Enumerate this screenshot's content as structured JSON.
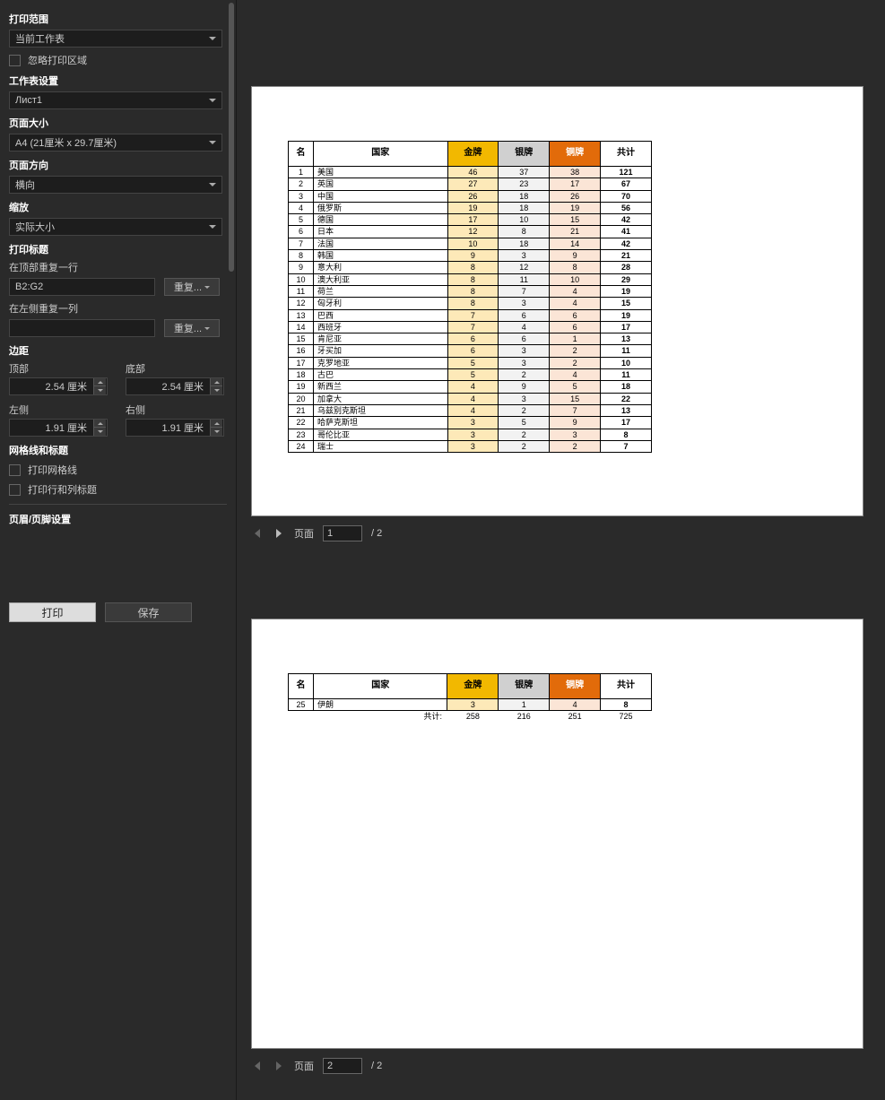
{
  "sidebar": {
    "print_range": {
      "title": "打印范围",
      "value": "当前工作表"
    },
    "ignore_print_area": "忽略打印区域",
    "sheet_settings": {
      "title": "工作表设置",
      "value": "Лист1"
    },
    "page_size": {
      "title": "页面大小",
      "value": "A4 (21厘米 x 29.7厘米)"
    },
    "page_orientation": {
      "title": "页面方向",
      "value": "横向"
    },
    "scaling": {
      "title": "缩放",
      "value": "实际大小"
    },
    "print_titles": {
      "title": "打印标题",
      "repeat_row_label": "在顶部重复一行",
      "repeat_row_value": "B2:G2",
      "repeat_col_label": "在左侧重复一列",
      "repeat_button": "重复..."
    },
    "margins": {
      "title": "边距",
      "top_label": "顶部",
      "bottom_label": "底部",
      "left_label": "左侧",
      "right_label": "右侧",
      "top": "2.54 厘米",
      "bottom": "2.54 厘米",
      "left": "1.91 厘米",
      "right": "1.91 厘米"
    },
    "gridlines": {
      "title": "网格线和标题",
      "print_gridlines": "打印网格线",
      "print_headings": "打印行和列标题"
    },
    "header_footer": "页眉/页脚设置",
    "print_button": "打印",
    "save_button": "保存"
  },
  "headers": {
    "rank": "名",
    "country": "国家",
    "gold": "金牌",
    "silver": "银牌",
    "bronze": "铜牌",
    "total": "共计"
  },
  "page1_rows": [
    {
      "rank": "1",
      "country": "美国",
      "gold": "46",
      "silver": "37",
      "bronze": "38",
      "total": "121"
    },
    {
      "rank": "2",
      "country": "英国",
      "gold": "27",
      "silver": "23",
      "bronze": "17",
      "total": "67"
    },
    {
      "rank": "3",
      "country": "中国",
      "gold": "26",
      "silver": "18",
      "bronze": "26",
      "total": "70"
    },
    {
      "rank": "4",
      "country": "俄罗斯",
      "gold": "19",
      "silver": "18",
      "bronze": "19",
      "total": "56"
    },
    {
      "rank": "5",
      "country": "德国",
      "gold": "17",
      "silver": "10",
      "bronze": "15",
      "total": "42"
    },
    {
      "rank": "6",
      "country": "日本",
      "gold": "12",
      "silver": "8",
      "bronze": "21",
      "total": "41"
    },
    {
      "rank": "7",
      "country": "法国",
      "gold": "10",
      "silver": "18",
      "bronze": "14",
      "total": "42"
    },
    {
      "rank": "8",
      "country": "韩国",
      "gold": "9",
      "silver": "3",
      "bronze": "9",
      "total": "21"
    },
    {
      "rank": "9",
      "country": "意大利",
      "gold": "8",
      "silver": "12",
      "bronze": "8",
      "total": "28"
    },
    {
      "rank": "10",
      "country": "澳大利亚",
      "gold": "8",
      "silver": "11",
      "bronze": "10",
      "total": "29"
    },
    {
      "rank": "11",
      "country": "荷兰",
      "gold": "8",
      "silver": "7",
      "bronze": "4",
      "total": "19"
    },
    {
      "rank": "12",
      "country": "匈牙利",
      "gold": "8",
      "silver": "3",
      "bronze": "4",
      "total": "15"
    },
    {
      "rank": "13",
      "country": "巴西",
      "gold": "7",
      "silver": "6",
      "bronze": "6",
      "total": "19"
    },
    {
      "rank": "14",
      "country": "西班牙",
      "gold": "7",
      "silver": "4",
      "bronze": "6",
      "total": "17"
    },
    {
      "rank": "15",
      "country": "肯尼亚",
      "gold": "6",
      "silver": "6",
      "bronze": "1",
      "total": "13"
    },
    {
      "rank": "16",
      "country": "牙买加",
      "gold": "6",
      "silver": "3",
      "bronze": "2",
      "total": "11"
    },
    {
      "rank": "17",
      "country": "克罗地亚",
      "gold": "5",
      "silver": "3",
      "bronze": "2",
      "total": "10"
    },
    {
      "rank": "18",
      "country": "古巴",
      "gold": "5",
      "silver": "2",
      "bronze": "4",
      "total": "11"
    },
    {
      "rank": "19",
      "country": "新西兰",
      "gold": "4",
      "silver": "9",
      "bronze": "5",
      "total": "18"
    },
    {
      "rank": "20",
      "country": "加拿大",
      "gold": "4",
      "silver": "3",
      "bronze": "15",
      "total": "22"
    },
    {
      "rank": "21",
      "country": "乌兹别克斯坦",
      "gold": "4",
      "silver": "2",
      "bronze": "7",
      "total": "13"
    },
    {
      "rank": "22",
      "country": "哈萨克斯坦",
      "gold": "3",
      "silver": "5",
      "bronze": "9",
      "total": "17"
    },
    {
      "rank": "23",
      "country": "哥伦比亚",
      "gold": "3",
      "silver": "2",
      "bronze": "3",
      "total": "8"
    },
    {
      "rank": "24",
      "country": "瑞士",
      "gold": "3",
      "silver": "2",
      "bronze": "2",
      "total": "7"
    }
  ],
  "page2_rows": [
    {
      "rank": "25",
      "country": "伊朗",
      "gold": "3",
      "silver": "1",
      "bronze": "4",
      "total": "8"
    }
  ],
  "totals": {
    "label": "共计:",
    "gold": "258",
    "silver": "216",
    "bronze": "251",
    "total": "725"
  },
  "nav": {
    "page_label": "页面",
    "page1": "1",
    "page2": "2",
    "of": "/ 2"
  }
}
